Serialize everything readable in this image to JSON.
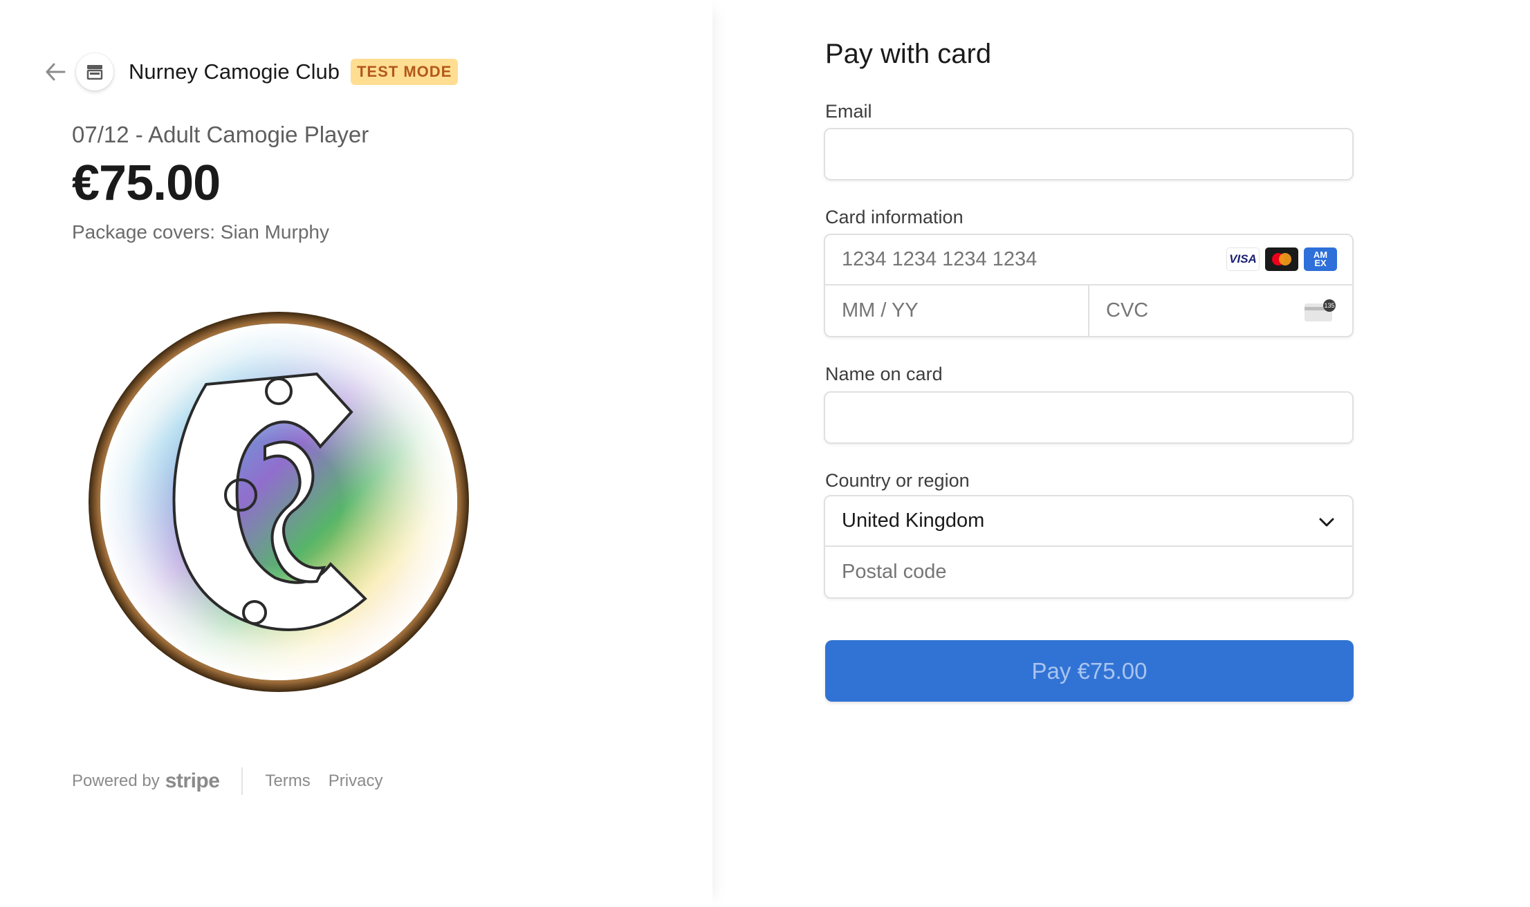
{
  "merchant": {
    "name": "Nurney Camogie Club",
    "test_badge": "TEST MODE"
  },
  "product": {
    "name": "07/12 - Adult Camogie Player",
    "price": "€75.00",
    "description": "Package covers: Sian Murphy",
    "image_icon": "camogie-association-logo"
  },
  "footer": {
    "powered_by": "Powered by",
    "brand": "stripe",
    "terms": "Terms",
    "privacy": "Privacy"
  },
  "form": {
    "title": "Pay with card",
    "email_label": "Email",
    "email_value": "",
    "card_label": "Card information",
    "card_number_placeholder": "1234 1234 1234 1234",
    "card_brands": [
      "VISA",
      "Mastercard",
      "AMEX"
    ],
    "expiry_placeholder": "MM / YY",
    "cvc_placeholder": "CVC",
    "cvc_icon_text": "135",
    "name_label": "Name on card",
    "name_value": "",
    "country_label": "Country or region",
    "country_value": "United Kingdom",
    "postal_placeholder": "Postal code",
    "pay_button": "Pay €75.00"
  },
  "colors": {
    "accent": "#3173d4",
    "badge_bg": "#ffde92",
    "badge_text": "#b3581a"
  }
}
